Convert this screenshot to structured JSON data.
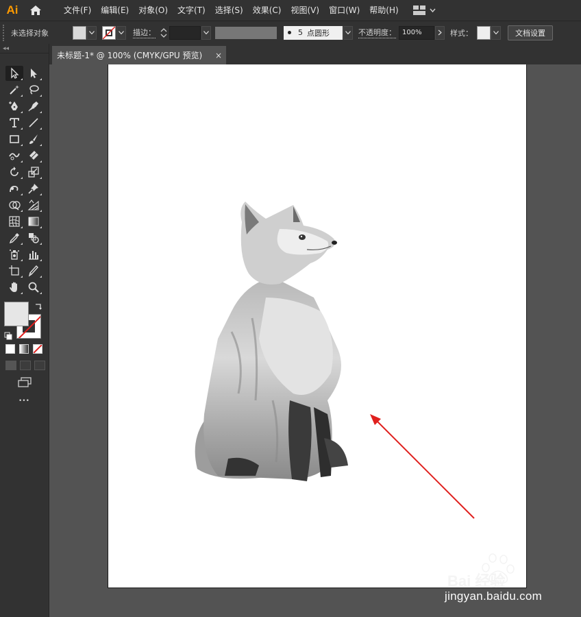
{
  "app": {
    "logo": "Ai",
    "menu": [
      "文件(F)",
      "编辑(E)",
      "对象(O)",
      "文字(T)",
      "选择(S)",
      "效果(C)",
      "视图(V)",
      "窗口(W)",
      "帮助(H)"
    ]
  },
  "control_bar": {
    "selection_status": "未选择对象",
    "stroke_label": "描边：",
    "brush_size": "5",
    "brush_name": "点圆形",
    "opacity_label": "不透明度：",
    "opacity_value": "100%",
    "style_label": "样式：",
    "doc_settings_button": "文档设置"
  },
  "document": {
    "tab_title": "未标题-1* @ 100% (CMYK/GPU 预览)",
    "tab_close": "×"
  },
  "toolbar": {
    "collapse": "◂◂",
    "more": "•••",
    "tools": [
      "selection-tool",
      "direct-selection-tool",
      "magic-wand-tool",
      "lasso-tool",
      "pen-tool",
      "curvature-tool",
      "type-tool",
      "line-tool",
      "rectangle-tool",
      "paintbrush-tool",
      "shaper-tool",
      "eraser-tool",
      "rotate-tool",
      "scale-tool",
      "warp-tool",
      "puppet-warp-tool",
      "shape-builder-tool",
      "perspective-grid-tool",
      "mesh-tool",
      "gradient-tool",
      "eyedropper-tool",
      "blend-tool",
      "symbol-sprayer-tool",
      "column-graph-tool",
      "artboard-tool",
      "slice-tool",
      "hand-tool",
      "zoom-tool"
    ],
    "fill_color": "#e6e6e6",
    "stroke": "none"
  },
  "canvas": {
    "artboard_color": "#ffffff",
    "annotation_arrow_color": "#e0201e"
  },
  "watermark": {
    "brand": "Bai 经验",
    "url": "jingyan.baidu.com"
  }
}
